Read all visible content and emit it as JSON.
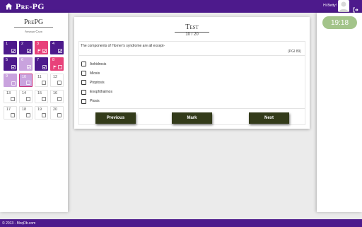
{
  "header": {
    "brand": "Pre-PG",
    "greeting": "Hi Betty!",
    "icons": {
      "home": "home-icon",
      "avatar": "avatar-icon",
      "logout": "logout-icon"
    },
    "color": "#4d1a8c"
  },
  "answer_card": {
    "title": "PrePG",
    "subtitle": "Answer Card",
    "status_colors": {
      "answered": "#4d1a8c",
      "marked": "#e8427a",
      "visited": "#c9a3de",
      "unanswered": "#ffffff"
    },
    "cells": [
      {
        "num": "1",
        "status": "answered",
        "icons": [
          "check-icon"
        ]
      },
      {
        "num": "2",
        "status": "answered",
        "icons": [
          "check-icon"
        ]
      },
      {
        "num": "3",
        "status": "marked",
        "icons": [
          "flag-icon",
          "check-icon"
        ]
      },
      {
        "num": "4",
        "status": "answered",
        "icons": [
          "check-icon"
        ]
      },
      {
        "num": "5",
        "status": "answered",
        "icons": [
          "check-icon"
        ]
      },
      {
        "num": "6",
        "status": "visited",
        "icons": [
          "check-icon"
        ]
      },
      {
        "num": "7",
        "status": "answered",
        "icons": [
          "check-icon"
        ]
      },
      {
        "num": "8",
        "status": "marked",
        "icons": [
          "flag-icon",
          "checkbox-icon"
        ]
      },
      {
        "num": "9",
        "status": "visited",
        "icons": [
          "checkbox-icon"
        ]
      },
      {
        "num": "10",
        "status": "current",
        "icons": [
          "checkbox-icon"
        ]
      },
      {
        "num": "11",
        "status": "unanswered",
        "icons": [
          "checkbox-icon"
        ]
      },
      {
        "num": "12",
        "status": "unanswered",
        "icons": [
          "checkbox-icon"
        ]
      },
      {
        "num": "13",
        "status": "unanswered",
        "icons": [
          "checkbox-icon"
        ]
      },
      {
        "num": "14",
        "status": "unanswered",
        "icons": [
          "checkbox-icon"
        ]
      },
      {
        "num": "15",
        "status": "unanswered",
        "icons": [
          "checkbox-icon"
        ]
      },
      {
        "num": "16",
        "status": "unanswered",
        "icons": [
          "checkbox-icon"
        ]
      },
      {
        "num": "17",
        "status": "unanswered",
        "icons": [
          "checkbox-icon"
        ]
      },
      {
        "num": "18",
        "status": "unanswered",
        "icons": [
          "checkbox-icon"
        ]
      },
      {
        "num": "19",
        "status": "unanswered",
        "icons": [
          "checkbox-icon"
        ]
      },
      {
        "num": "20",
        "status": "unanswered",
        "icons": [
          "checkbox-icon"
        ]
      }
    ]
  },
  "test": {
    "title": "Test",
    "counter": "10 / 20",
    "question": "The components of Horner's syndrome are all except-",
    "source": "(PGI 89)",
    "options": [
      {
        "label": "Anhidrosis",
        "checked": false
      },
      {
        "label": "Miosis",
        "checked": false
      },
      {
        "label": "Ptoptosis",
        "checked": false
      },
      {
        "label": "Enophthalmos",
        "checked": false
      },
      {
        "label": "Ptosis",
        "checked": false
      }
    ],
    "buttons": {
      "previous": "Previous",
      "mark": "Mark",
      "next": "Next"
    },
    "button_color": "#333b1a"
  },
  "timer": {
    "value": "19:18",
    "color": "#a3c48a"
  },
  "footer": {
    "text": "© 2013 - McqDb.com"
  }
}
